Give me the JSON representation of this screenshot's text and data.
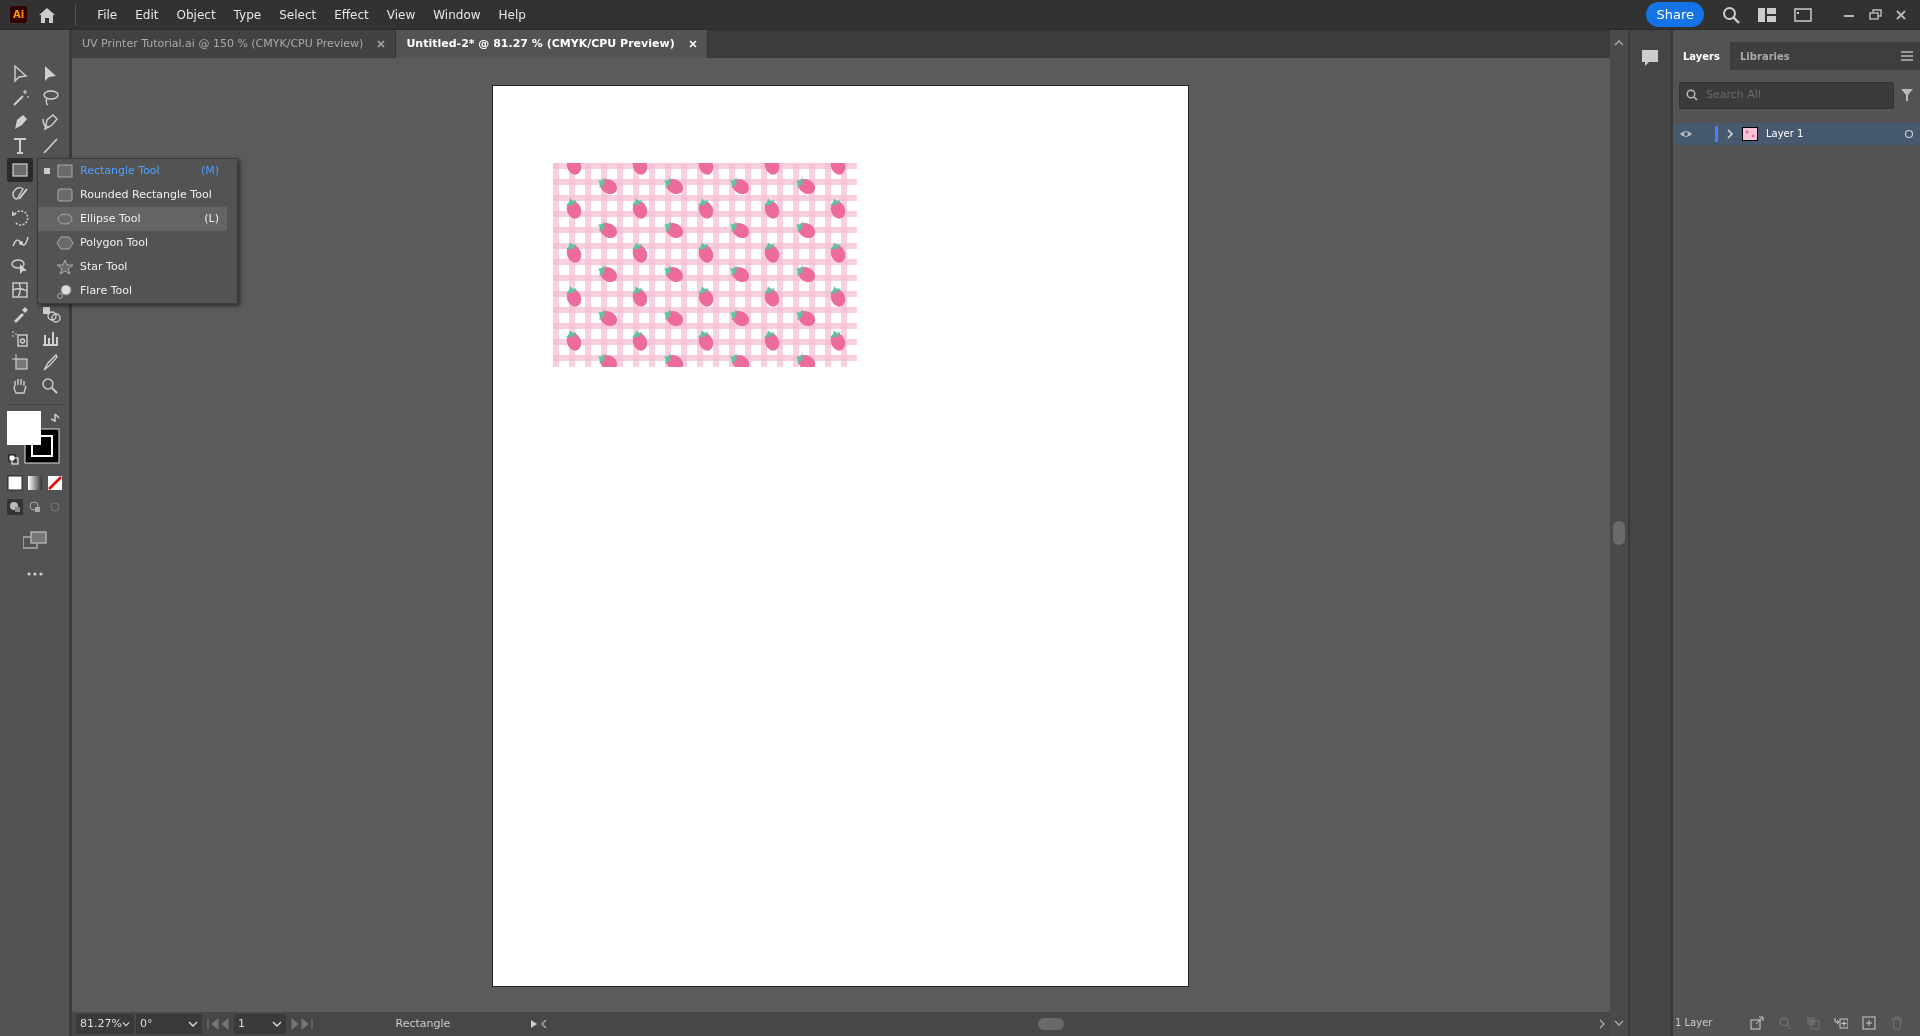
{
  "app_bar": {
    "logo": "Ai",
    "menus": [
      "File",
      "Edit",
      "Object",
      "Type",
      "Select",
      "Effect",
      "View",
      "Window",
      "Help"
    ],
    "share_button": "Share"
  },
  "document_tabs": [
    {
      "label": "UV Printer Tutorial.ai @ 150 % (CMYK/CPU Preview)",
      "selected": false
    },
    {
      "label": "Untitled-2* @ 81.27 % (CMYK/CPU Preview)",
      "selected": true
    }
  ],
  "shape_tools_flyout": [
    {
      "kind": "rectangle",
      "label": "Rectangle Tool",
      "shortcut": "(M)",
      "selected": true,
      "highlighted": false
    },
    {
      "kind": "rounded-rectangle",
      "label": "Rounded Rectangle Tool",
      "selected": false,
      "highlighted": false
    },
    {
      "kind": "ellipse",
      "label": "Ellipse Tool",
      "shortcut": "(L)",
      "selected": false,
      "highlighted": true
    },
    {
      "kind": "polygon",
      "label": "Polygon Tool",
      "selected": false,
      "highlighted": false
    },
    {
      "kind": "star",
      "label": "Star Tool",
      "selected": false,
      "highlighted": false
    },
    {
      "kind": "flare",
      "label": "Flare Tool",
      "selected": false,
      "highlighted": false
    }
  ],
  "panel_tabs": [
    {
      "label": "Layers",
      "selected": true
    },
    {
      "label": "Libraries",
      "selected": false
    }
  ],
  "layers_search": {
    "placeholder": "Search All"
  },
  "layers": [
    {
      "name": "Layer 1",
      "visible": true,
      "selected": true,
      "color": "#4f7cff"
    }
  ],
  "layers_footer": "1 Layer",
  "status_bar": {
    "zoom": "81.27%",
    "rotation": "0°",
    "artboard": "1",
    "tool": "Rectangle"
  }
}
